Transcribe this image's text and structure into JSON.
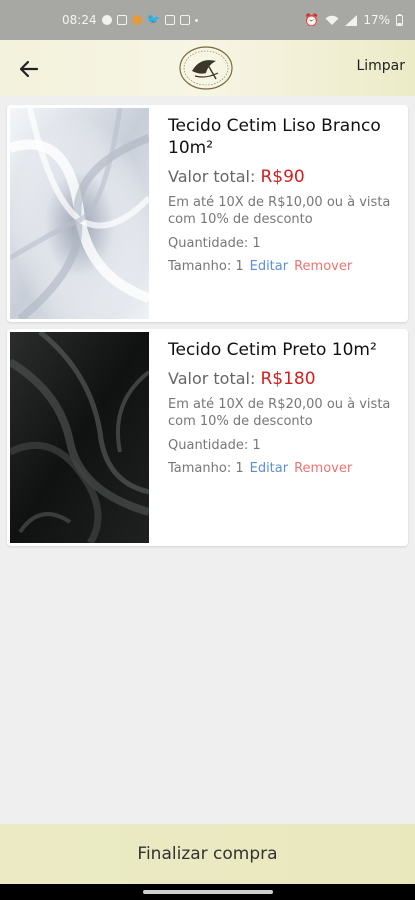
{
  "statusbar": {
    "time": "08:24",
    "battery": "17%"
  },
  "appbar": {
    "back_icon": "arrow-left-icon",
    "logo_icon": "store-logo",
    "clear_label": "Limpar"
  },
  "cart": {
    "items": [
      {
        "title": "Tecido Cetim Liso Branco 10m²",
        "total_label": "Valor total:",
        "price": "R$90",
        "installments": "Em até 10X de R$10,00 ou à vista com 10% de desconto",
        "quantity": "Quantidade: 1",
        "size": "Tamanho: 1",
        "edit_label": "Editar",
        "remove_label": "Remover",
        "image": "white-satin-fabric"
      },
      {
        "title": "Tecido Cetim Preto 10m²",
        "total_label": "Valor total:",
        "price": "R$180",
        "installments": "Em até 10X de R$20,00 ou à vista com 10% de desconto",
        "quantity": "Quantidade: 1",
        "size": "Tamanho: 1",
        "edit_label": "Editar",
        "remove_label": "Remover",
        "image": "black-satin-fabric"
      }
    ]
  },
  "checkout": {
    "label": "Finalizar compra"
  },
  "colors": {
    "price": "#d21f1f",
    "edit": "#5b8fd6",
    "remove": "#ef7272",
    "appbar": "#f3f2dc",
    "checkout": "#ebeac5"
  }
}
